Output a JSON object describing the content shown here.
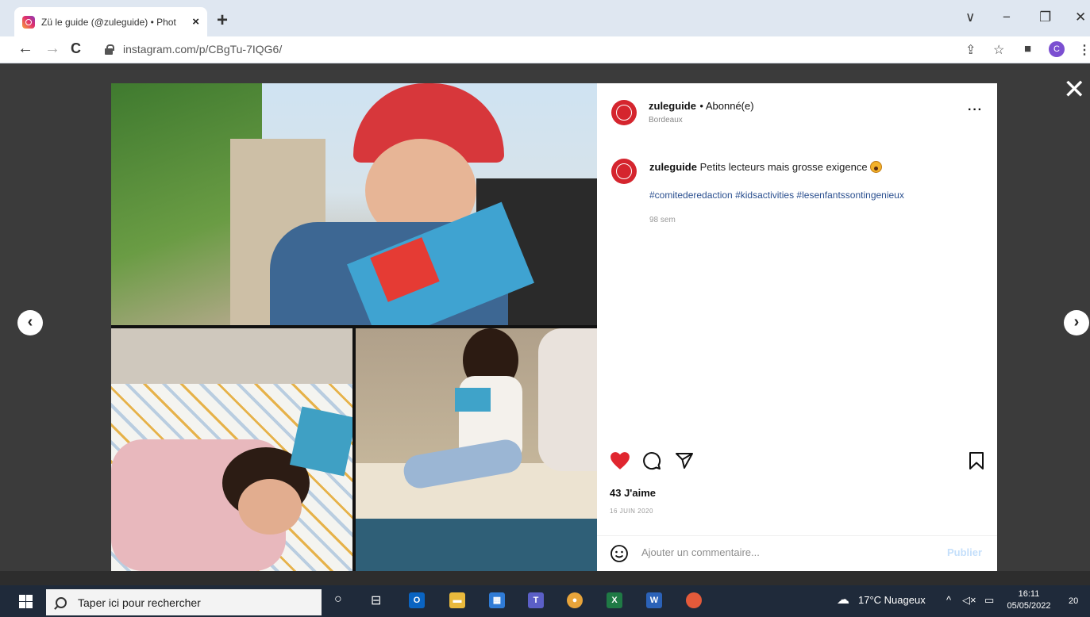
{
  "browser": {
    "tab_title": "Zü le guide (@zuleguide) • Phot",
    "tab_close": "×",
    "new_tab": "+",
    "url": "instagram.com/p/CBgTu-7IQG6/",
    "profile_initial": "C",
    "window_controls": [
      "∨",
      "−",
      "❐",
      "✕"
    ]
  },
  "overlay": {
    "close_label": "✕",
    "prev_label": "‹",
    "next_label": "›"
  },
  "post": {
    "username": "zuleguide",
    "follow_status": "• Abonné(e)",
    "location": "Bordeaux",
    "more": "···",
    "caption_user": "zuleguide",
    "caption_text": "Petits lecteurs mais grosse exigence",
    "hashtags": "#comitederedaction #kidsactivities #lesenfantssontingenieux",
    "time_ago": "98 sem",
    "likes": "43 J'aime",
    "date": "16 JUIN 2020",
    "comment_placeholder": "Ajouter un commentaire...",
    "publish": "Publier",
    "like_color": "#e0262f"
  },
  "taskbar": {
    "search_placeholder": "Taper ici pour rechercher",
    "weather": "17°C  Nuageux",
    "time": "16:11",
    "date": "05/05/2022",
    "notifications": "20",
    "apps": [
      {
        "icon": "outlook-icon",
        "label": "O",
        "color": "#0a64c2"
      },
      {
        "icon": "file-explorer-icon",
        "label": "▬",
        "color": "#e9b93c"
      },
      {
        "icon": "store-icon",
        "label": "▦",
        "color": "#2f7bd6"
      },
      {
        "icon": "teams-icon",
        "label": "T",
        "color": "#5b5fc7"
      },
      {
        "icon": "chrome-icon",
        "label": "●",
        "color": "#e8a43a"
      },
      {
        "icon": "excel-icon",
        "label": "X",
        "color": "#1f7a45"
      },
      {
        "icon": "word-icon",
        "label": "W",
        "color": "#2b62b8"
      }
    ]
  }
}
